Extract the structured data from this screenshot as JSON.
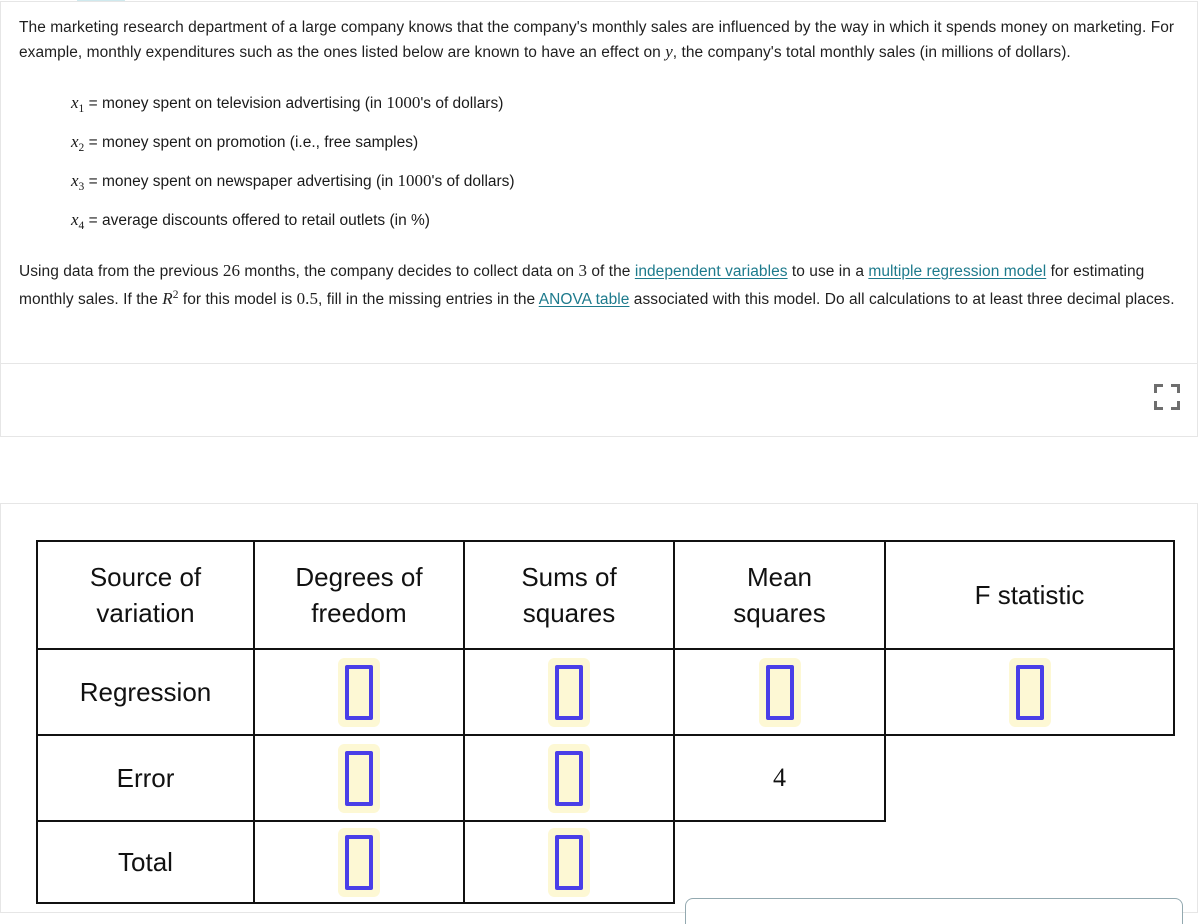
{
  "problem": {
    "intro_part1": "The marketing research department of a large company knows that the company's monthly sales are influenced by the way in which it spends money on marketing. For example, monthly expenditures such as the ones listed below are known to have an effect on ",
    "intro_y": "y",
    "intro_part2": ", the company's total monthly sales (in millions of dollars).",
    "variables": [
      {
        "symbol": "x",
        "subscript": "1",
        "equals": "=",
        "text_before_num": " money spent on television advertising (in ",
        "number": "1000",
        "text_after_num": "'s of dollars)"
      },
      {
        "symbol": "x",
        "subscript": "2",
        "equals": "=",
        "text_before_num": " money spent on promotion (i.e., free samples)",
        "number": "",
        "text_after_num": ""
      },
      {
        "symbol": "x",
        "subscript": "3",
        "equals": "=",
        "text_before_num": " money spent on newspaper advertising (in ",
        "number": "1000",
        "text_after_num": "'s of dollars)"
      },
      {
        "symbol": "x",
        "subscript": "4",
        "equals": "=",
        "text_before_num": " average discounts offered to retail outlets (in %)",
        "number": "",
        "text_after_num": ""
      }
    ],
    "closing": {
      "s1": "Using data from the previous ",
      "n_months": "26",
      "s2": " months, the company decides to collect data on ",
      "n_vars": "3",
      "s3": " of the ",
      "link1": "independent variables",
      "s4": " to use in a ",
      "link2": "multiple regression model",
      "s5": " for estimating monthly sales. If the ",
      "r_symbol": "R",
      "r_exponent": "2",
      "s6": " for this model is ",
      "r2_value": "0.5",
      "s7": ", fill in the missing entries in the ",
      "link3": "ANOVA table",
      "s8": " associated with this model. Do all calculations to at least three decimal places."
    }
  },
  "toolbar": {
    "expand_icon": "fullscreen-expand-icon"
  },
  "anova_table": {
    "headers": [
      {
        "line1": "Source of",
        "line2": "variation"
      },
      {
        "line1": "Degrees of",
        "line2": "freedom"
      },
      {
        "line1": "Sums of",
        "line2": "squares"
      },
      {
        "line1": "Mean",
        "line2": "squares"
      },
      {
        "line1": "F statistic",
        "line2": ""
      }
    ],
    "rows": [
      {
        "label": "Regression",
        "cells": [
          {
            "type": "input",
            "value": ""
          },
          {
            "type": "input",
            "value": ""
          },
          {
            "type": "input",
            "value": ""
          },
          {
            "type": "input",
            "value": ""
          }
        ]
      },
      {
        "label": "Error",
        "cells": [
          {
            "type": "input",
            "value": ""
          },
          {
            "type": "input",
            "value": ""
          },
          {
            "type": "static",
            "value": "4"
          },
          {
            "type": "empty",
            "value": ""
          }
        ]
      },
      {
        "label": "Total",
        "cells": [
          {
            "type": "input",
            "value": ""
          },
          {
            "type": "input",
            "value": ""
          },
          {
            "type": "empty",
            "value": ""
          },
          {
            "type": "empty",
            "value": ""
          }
        ]
      }
    ]
  },
  "colors": {
    "link": "#1d7a8c",
    "input_border": "#4a3fe8",
    "input_fill": "#fdf8d4",
    "table_border": "#111111",
    "pill": "#cfe9ee",
    "bottom_bar_border": "#93a9b0"
  }
}
